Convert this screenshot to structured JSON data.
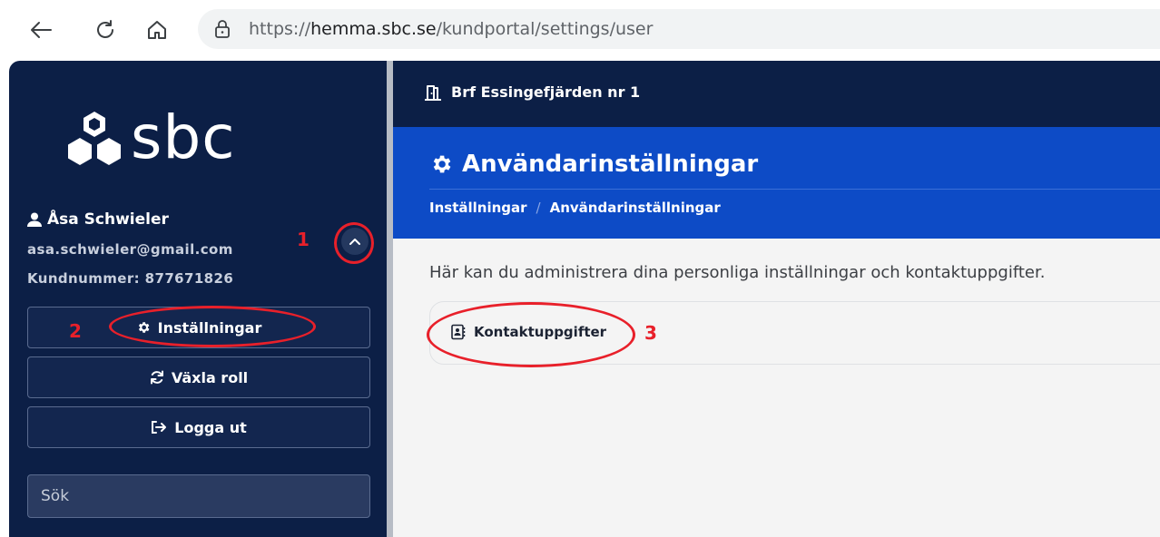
{
  "browser": {
    "url_prefix": "https://",
    "url_host": "hemma.sbc.se",
    "url_path": "/kundportal/settings/user"
  },
  "sidebar": {
    "logo_text": "sbc",
    "user_name": "Åsa Schwieler",
    "user_email": "asa.schwieler@gmail.com",
    "customer_number": "Kundnummer: 877671826",
    "buttons": {
      "settings": "Inställningar",
      "switch_role": "Växla roll",
      "logout": "Logga ut"
    },
    "search_placeholder": "Sök"
  },
  "topbar": {
    "organization": "Brf Essingefjärden nr 1"
  },
  "hero": {
    "title": "Användarinställningar",
    "breadcrumb": [
      "Inställningar",
      "/",
      "Användarinställningar"
    ]
  },
  "main": {
    "description": "Här kan du administrera dina personliga inställningar och kontaktuppgifter.",
    "card_link": "Kontaktuppgifter"
  },
  "annotations": [
    "1",
    "2",
    "3"
  ],
  "colors": {
    "sidebar_bg": "#0c1f46",
    "hero_bg": "#0d4bc6",
    "annotation": "#e8202a"
  }
}
